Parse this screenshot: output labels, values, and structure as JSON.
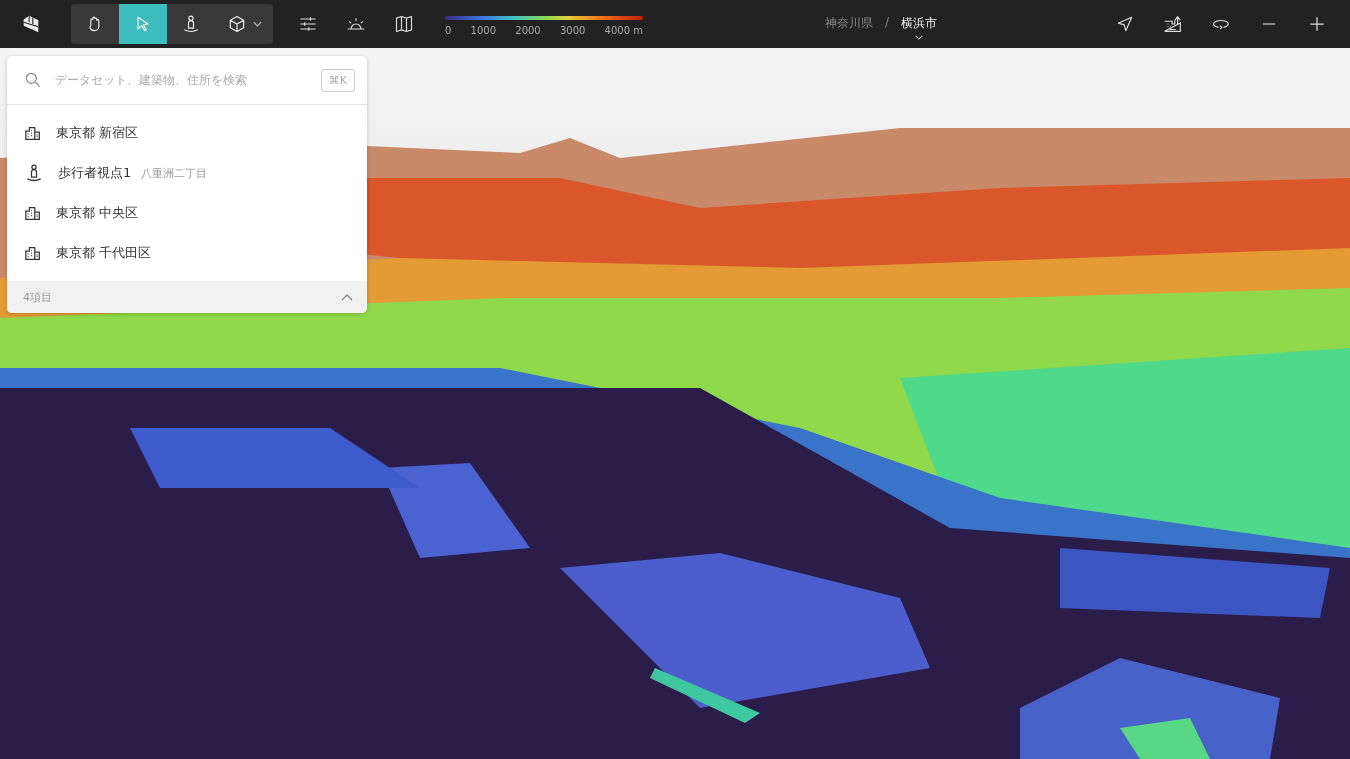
{
  "tools": [
    {
      "kind": "hand",
      "selected": false
    },
    {
      "kind": "pointer",
      "selected": true
    },
    {
      "kind": "pedestrian",
      "selected": false
    },
    {
      "kind": "cube",
      "selected": false,
      "dropdown": true
    }
  ],
  "legend": {
    "labels": [
      "0",
      "1000",
      "2000",
      "3000",
      "4000 m"
    ]
  },
  "breadcrumb": {
    "parent": "神奈川県",
    "separator": "/",
    "current": "横浜市"
  },
  "search": {
    "placeholder": "データセット、建築物、住所を検索",
    "shortcut": "⌘K",
    "results": [
      {
        "kind": "area",
        "label": "東京都 新宿区"
      },
      {
        "kind": "pedestrian",
        "label": "歩行者視点1",
        "detail": "八重洲二丁目"
      },
      {
        "kind": "area",
        "label": "東京都 中央区"
      },
      {
        "kind": "area",
        "label": "東京都 千代田区"
      }
    ],
    "count": "4項目",
    "expanded": true
  }
}
